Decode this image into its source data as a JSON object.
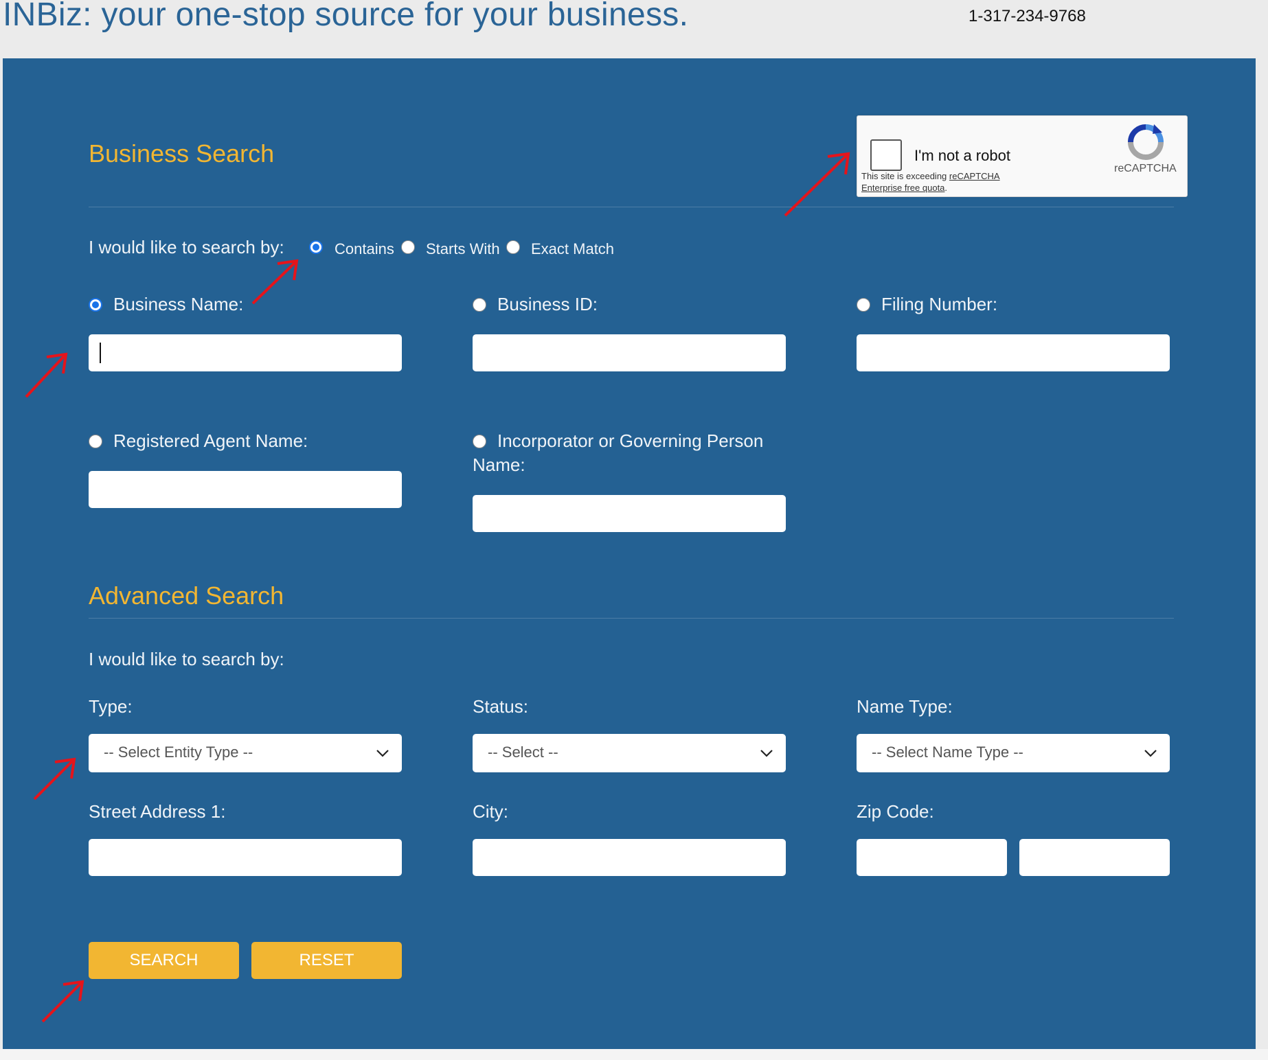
{
  "header": {
    "title": "INBiz: your one-stop source for your business.",
    "phone": "1-317-234-9768"
  },
  "business_search": {
    "title": "Business Search",
    "search_by_label": "I would like to search by:",
    "match_options": [
      "Contains",
      "Starts With",
      "Exact Match"
    ],
    "match_selected": "Contains",
    "fields": {
      "business_name": "Business Name:",
      "business_id": "Business ID:",
      "filing_number": "Filing Number:",
      "registered_agent": "Registered Agent Name:",
      "incorporator_line1": "Incorporator or Governing Person",
      "incorporator_line2": "Name:"
    },
    "field_selected": "Business Name:"
  },
  "captcha": {
    "label": "I'm not a robot",
    "warning_prefix": "This site is exceeding ",
    "warning_link1": "reCAPTCHA",
    "warning_link2": "Enterprise free quota",
    "warning_suffix": ".",
    "brand": "reCAPTCHA"
  },
  "advanced_search": {
    "title": "Advanced Search",
    "search_by_label": "I would like to search by:",
    "type_label": "Type:",
    "type_value": "-- Select Entity Type --",
    "status_label": "Status:",
    "status_value": "-- Select --",
    "name_type_label": "Name Type:",
    "name_type_value": "-- Select Name Type --",
    "street_label": "Street Address 1:",
    "city_label": "City:",
    "zip_label": "Zip Code:"
  },
  "buttons": {
    "search": "SEARCH",
    "reset": "RESET"
  },
  "colors": {
    "panel": "#246193",
    "accent": "#f2b632",
    "header_text": "#2a6496",
    "annotation": "#e5141b"
  },
  "annotations": "red-arrow-icon"
}
